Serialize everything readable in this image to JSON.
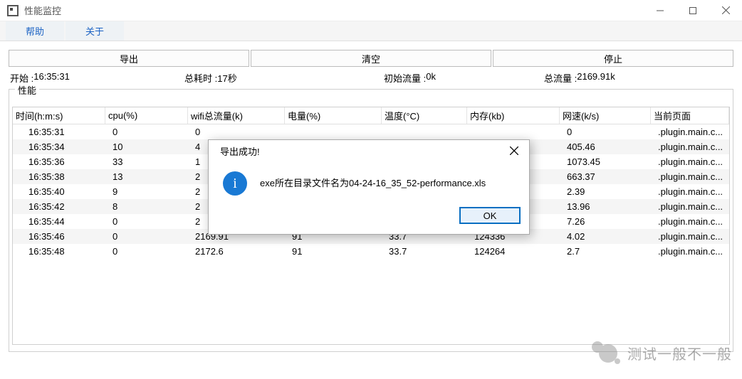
{
  "window": {
    "title": "性能监控"
  },
  "menu": {
    "help": "帮助",
    "about": "关于"
  },
  "actions": {
    "export": "导出",
    "clear": "清空",
    "stop": "停止"
  },
  "stats": {
    "start_label": "开始 :",
    "start_value": "16:35:31",
    "elapsed_label": "总耗时 : ",
    "elapsed_value": "17秒",
    "init_traffic_label": "初始流量 :",
    "init_traffic_value": "0k",
    "total_traffic_label": "总流量 : ",
    "total_traffic_value": "2169.91k"
  },
  "group_legend": "性能",
  "columns": {
    "time": "时间(h:m:s)",
    "cpu": "cpu(%)",
    "wifi": "wifi总流量(k)",
    "battery": "电量(%)",
    "temp": "温度(°C)",
    "mem": "内存(kb)",
    "net": "网速(k/s)",
    "page": "当前页面"
  },
  "rows": [
    {
      "time": "16:35:31",
      "cpu": "0",
      "wifi": "0",
      "battery": "",
      "temp": "",
      "mem": "",
      "net": "0",
      "page": ".plugin.main.c..."
    },
    {
      "time": "16:35:34",
      "cpu": "10",
      "wifi": "4",
      "battery": "",
      "temp": "",
      "mem": "",
      "net": "405.46",
      "page": ".plugin.main.c..."
    },
    {
      "time": "16:35:36",
      "cpu": "33",
      "wifi": "1",
      "battery": "",
      "temp": "",
      "mem": "",
      "net": "1073.45",
      "page": ".plugin.main.c..."
    },
    {
      "time": "16:35:38",
      "cpu": "13",
      "wifi": "2",
      "battery": "",
      "temp": "",
      "mem": "",
      "net": "663.37",
      "page": ".plugin.main.c..."
    },
    {
      "time": "16:35:40",
      "cpu": "9",
      "wifi": "2",
      "battery": "",
      "temp": "",
      "mem": "",
      "net": "2.39",
      "page": ".plugin.main.c..."
    },
    {
      "time": "16:35:42",
      "cpu": "8",
      "wifi": "2",
      "battery": "",
      "temp": "",
      "mem": "",
      "net": "13.96",
      "page": ".plugin.main.c..."
    },
    {
      "time": "16:35:44",
      "cpu": "0",
      "wifi": "2",
      "battery": "",
      "temp": "",
      "mem": "",
      "net": "7.26",
      "page": ".plugin.main.c..."
    },
    {
      "time": "16:35:46",
      "cpu": "0",
      "wifi": "2169.91",
      "battery": "91",
      "temp": "33.7",
      "mem": "124336",
      "net": "4.02",
      "page": ".plugin.main.c..."
    },
    {
      "time": "16:35:48",
      "cpu": "0",
      "wifi": "2172.6",
      "battery": "91",
      "temp": "33.7",
      "mem": "124264",
      "net": "2.7",
      "page": ".plugin.main.c..."
    }
  ],
  "dialog": {
    "title": "导出成功!",
    "message": "exe所在目录文件名为04-24-16_35_52-performance.xls",
    "ok": "OK"
  },
  "watermark": "测试一般不一般"
}
